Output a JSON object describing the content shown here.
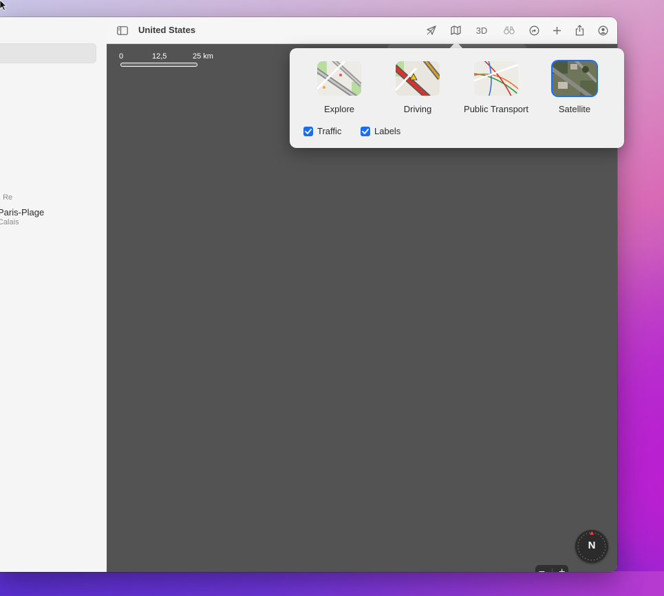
{
  "window": {
    "title": "United States"
  },
  "toolbar": {
    "sidebar_icon": "sidebar-toggle-icon",
    "location_icon": "location-arrow-icon",
    "map_icon": "map-icon",
    "three_d_label": "3D",
    "look_around_icon": "binoculars-icon",
    "route_icon": "directions-icon",
    "add_icon": "plus-icon",
    "share_icon": "share-icon",
    "account_icon": "account-icon"
  },
  "sidebar": {
    "items": [
      {
        "text": ", Re"
      },
      {
        "text": "Paris-Plage"
      },
      {
        "text": "Calais"
      }
    ]
  },
  "map": {
    "scale_labels": [
      "0",
      "12,5",
      "25 km"
    ],
    "zoom_out_label": "−",
    "zoom_in_label": "+",
    "compass_label": "N"
  },
  "map_style_popover": {
    "options": [
      {
        "label": "Explore",
        "selected": false
      },
      {
        "label": "Driving",
        "selected": false
      },
      {
        "label": "Public Transport",
        "selected": false
      },
      {
        "label": "Satellite",
        "selected": true
      }
    ],
    "toggles": [
      {
        "label": "Traffic",
        "checked": true
      },
      {
        "label": "Labels",
        "checked": true
      }
    ]
  },
  "colors": {
    "accent": "#1b6ef3",
    "map_background": "#535353"
  }
}
